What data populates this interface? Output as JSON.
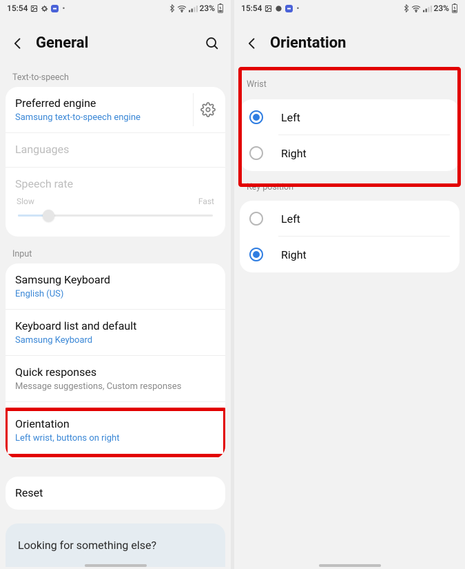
{
  "status": {
    "time": "15:54",
    "battery_text": "23%"
  },
  "left": {
    "title": "General",
    "sections": {
      "tts_label": "Text-to-speech",
      "engine": {
        "label": "Preferred engine",
        "sub": "Samsung text-to-speech engine"
      },
      "languages": {
        "label": "Languages"
      },
      "speech_rate": {
        "label": "Speech rate",
        "slow": "Slow",
        "fast": "Fast"
      },
      "input_label": "Input",
      "keyboard": {
        "label": "Samsung Keyboard",
        "sub": "English (US)"
      },
      "kbd_list": {
        "label": "Keyboard list and default",
        "sub": "Samsung Keyboard"
      },
      "quick": {
        "label": "Quick responses",
        "sub": "Message suggestions, Custom responses"
      },
      "orientation": {
        "label": "Orientation",
        "sub": "Left wrist, buttons on right"
      },
      "reset": {
        "label": "Reset"
      }
    },
    "footer": "Looking for something else?"
  },
  "right": {
    "title": "Orientation",
    "wrist_label": "Wrist",
    "wrist": {
      "left": "Left",
      "right": "Right",
      "selected": "left"
    },
    "keypos_label": "Key position",
    "keypos": {
      "left": "Left",
      "right": "Right",
      "selected": "right"
    }
  }
}
